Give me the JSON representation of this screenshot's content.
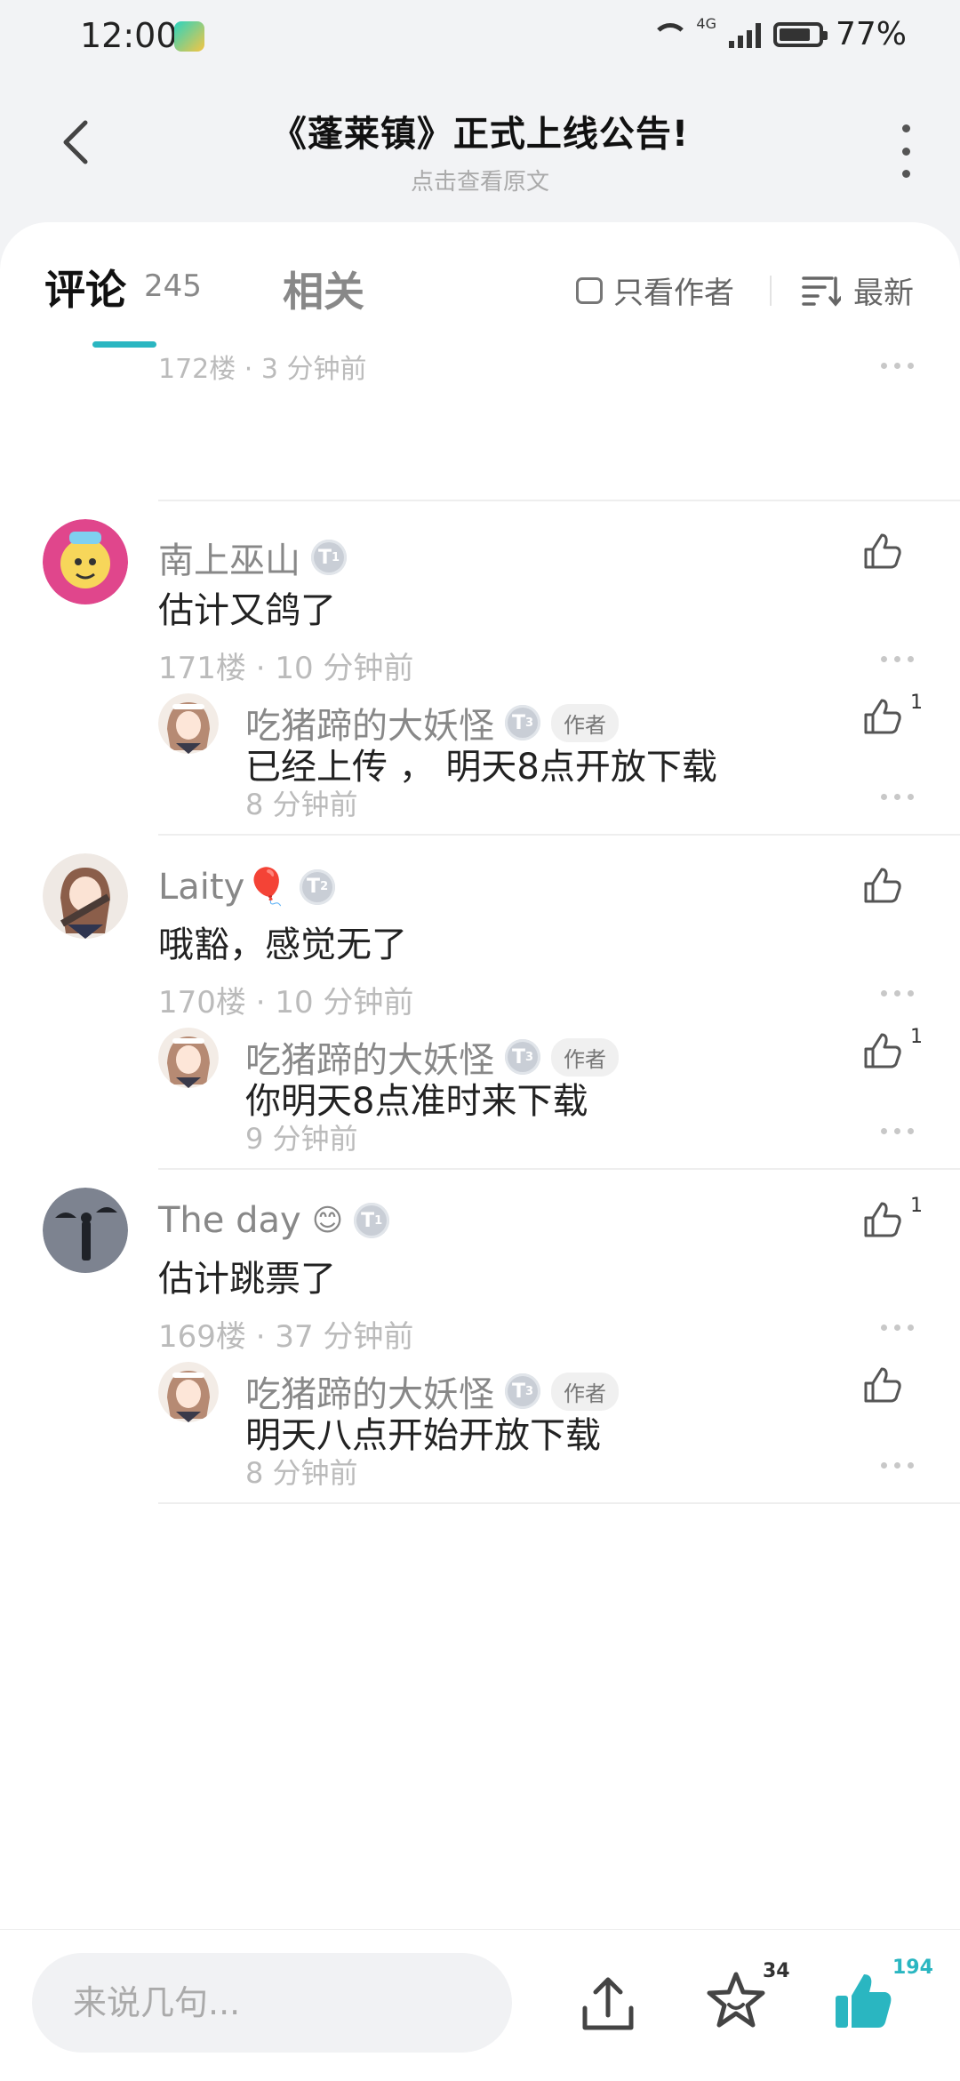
{
  "status_bar": {
    "time": "12:00",
    "network": "4G",
    "battery": "77%"
  },
  "header": {
    "title": "《蓬莱镇》正式上线公告!",
    "subtitle": "点击查看原文"
  },
  "tabs": {
    "comments_label": "评论",
    "comments_count": "245",
    "related_label": "相关",
    "only_author_label": "只看作者",
    "sort_label": "最新"
  },
  "partial_meta": "172楼 · 3 分钟前",
  "comments": [
    {
      "author": "南上巫山",
      "level": "1",
      "text": "估计又鸽了",
      "meta": "171楼 · 10 分钟前",
      "likes": "",
      "reply": {
        "author": "吃猪蹄的大妖怪",
        "level": "3",
        "tag": "作者",
        "text": "已经上传 ， 明天8点开放下载",
        "meta": "8 分钟前",
        "likes": "1"
      }
    },
    {
      "author": "Laity🎈",
      "level": "2",
      "text": "哦豁，感觉无了",
      "meta": "170楼 · 10 分钟前",
      "likes": "",
      "reply": {
        "author": "吃猪蹄的大妖怪",
        "level": "3",
        "tag": "作者",
        "text": "你明天8点准时来下载",
        "meta": "9 分钟前",
        "likes": "1"
      }
    },
    {
      "author": "The day",
      "level": "1",
      "text": "估计跳票了",
      "meta": "169楼 · 37 分钟前",
      "likes": "1",
      "reply": {
        "author": "吃猪蹄的大妖怪",
        "level": "3",
        "tag": "作者",
        "text": "明天八点开始开放下载",
        "meta": "8 分钟前",
        "likes": ""
      }
    }
  ],
  "bottom_bar": {
    "input_placeholder": "来说几句...",
    "favorites_count": "34",
    "likes_count": "194"
  },
  "colors": {
    "accent": "#2ab6c1",
    "muted": "#888888",
    "text": "#222222"
  }
}
